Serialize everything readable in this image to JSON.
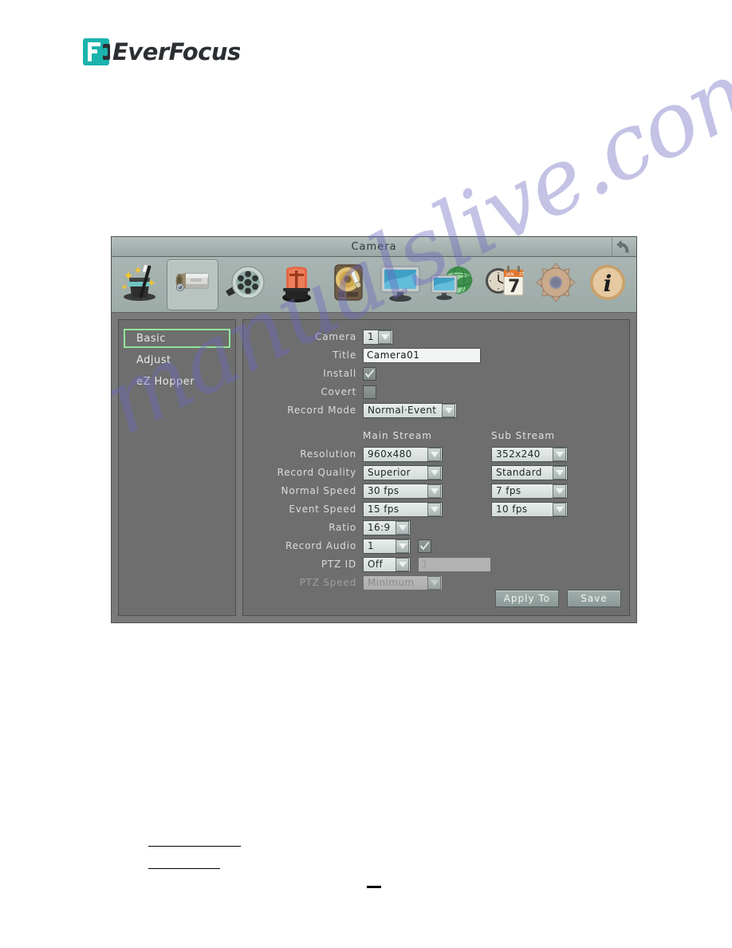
{
  "brand": {
    "name": "EverFocus",
    "logo_color": "#1bb3ad",
    "text_color": "#2b2f33"
  },
  "window": {
    "title": "Camera",
    "back_icon": "back-arrow-icon"
  },
  "toolbar": {
    "items": [
      {
        "id": "wizard",
        "icon": "magic-hat-icon",
        "selected": false
      },
      {
        "id": "camera",
        "icon": "camera-icon",
        "selected": true
      },
      {
        "id": "record",
        "icon": "film-reel-icon",
        "selected": false
      },
      {
        "id": "alarm",
        "icon": "alarm-beacon-icon",
        "selected": false
      },
      {
        "id": "disk",
        "icon": "hard-disk-icon",
        "selected": false
      },
      {
        "id": "display",
        "icon": "monitor-icon",
        "selected": false
      },
      {
        "id": "network",
        "icon": "globe-monitor-icon",
        "selected": false
      },
      {
        "id": "schedule",
        "icon": "clock-calendar-icon",
        "selected": false
      },
      {
        "id": "system",
        "icon": "gear-icon",
        "selected": false
      },
      {
        "id": "info",
        "icon": "info-icon",
        "selected": false
      }
    ],
    "calendar_month": "JAN",
    "calendar_day": "7",
    "info_letter": "i"
  },
  "sidebar": {
    "items": [
      {
        "label": "Basic",
        "active": true
      },
      {
        "label": "Adjust",
        "active": false
      },
      {
        "label": "eZ Hopper",
        "active": false
      }
    ],
    "highlight_color": "#93e59a"
  },
  "form": {
    "camera": {
      "label": "Camera",
      "value": "1"
    },
    "title": {
      "label": "Title",
      "value": "Camera01"
    },
    "install": {
      "label": "Install",
      "checked": true
    },
    "covert": {
      "label": "Covert",
      "checked": false
    },
    "record_mode": {
      "label": "Record Mode",
      "value": "Normal·Event"
    },
    "stream_headers": {
      "main": "Main  Stream",
      "sub": "Sub  Stream"
    },
    "rows": [
      {
        "label": "Resolution",
        "main": "960x480",
        "sub": "352x240"
      },
      {
        "label": "Record Quality",
        "main": "Superior",
        "sub": "Standard"
      },
      {
        "label": "Normal Speed",
        "main": "30  fps",
        "sub": "7  fps"
      },
      {
        "label": "Event Speed",
        "main": "15  fps",
        "sub": "10  fps"
      }
    ],
    "ratio": {
      "label": "Ratio",
      "value": "16:9"
    },
    "record_audio": {
      "label": "Record Audio",
      "value": "1",
      "checked": true
    },
    "ptz_id": {
      "label": "PTZ  ID",
      "value": "Off",
      "field_value": "1",
      "field_disabled": true
    },
    "ptz_speed": {
      "label": "PTZ  Speed",
      "value": "Minimum",
      "disabled": true
    }
  },
  "buttons": {
    "apply_to": "Apply  To",
    "save": "Save"
  },
  "watermark": {
    "text": "manualslive.com",
    "color": "#6c66be"
  }
}
